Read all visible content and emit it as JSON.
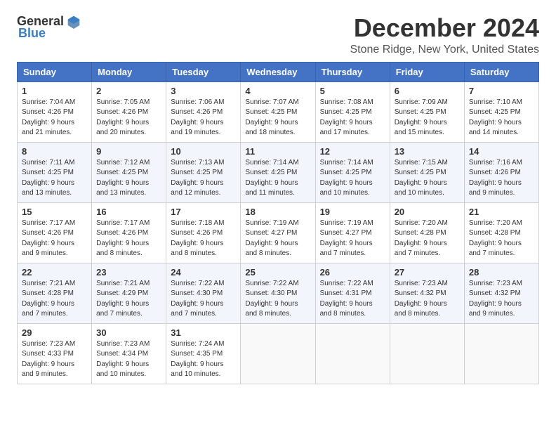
{
  "logo": {
    "general": "General",
    "blue": "Blue"
  },
  "title": "December 2024",
  "subtitle": "Stone Ridge, New York, United States",
  "headers": [
    "Sunday",
    "Monday",
    "Tuesday",
    "Wednesday",
    "Thursday",
    "Friday",
    "Saturday"
  ],
  "weeks": [
    [
      {
        "day": "1",
        "sunrise": "7:04 AM",
        "sunset": "4:26 PM",
        "daylight": "9 hours and 21 minutes."
      },
      {
        "day": "2",
        "sunrise": "7:05 AM",
        "sunset": "4:26 PM",
        "daylight": "9 hours and 20 minutes."
      },
      {
        "day": "3",
        "sunrise": "7:06 AM",
        "sunset": "4:26 PM",
        "daylight": "9 hours and 19 minutes."
      },
      {
        "day": "4",
        "sunrise": "7:07 AM",
        "sunset": "4:25 PM",
        "daylight": "9 hours and 18 minutes."
      },
      {
        "day": "5",
        "sunrise": "7:08 AM",
        "sunset": "4:25 PM",
        "daylight": "9 hours and 17 minutes."
      },
      {
        "day": "6",
        "sunrise": "7:09 AM",
        "sunset": "4:25 PM",
        "daylight": "9 hours and 15 minutes."
      },
      {
        "day": "7",
        "sunrise": "7:10 AM",
        "sunset": "4:25 PM",
        "daylight": "9 hours and 14 minutes."
      }
    ],
    [
      {
        "day": "8",
        "sunrise": "7:11 AM",
        "sunset": "4:25 PM",
        "daylight": "9 hours and 13 minutes."
      },
      {
        "day": "9",
        "sunrise": "7:12 AM",
        "sunset": "4:25 PM",
        "daylight": "9 hours and 13 minutes."
      },
      {
        "day": "10",
        "sunrise": "7:13 AM",
        "sunset": "4:25 PM",
        "daylight": "9 hours and 12 minutes."
      },
      {
        "day": "11",
        "sunrise": "7:14 AM",
        "sunset": "4:25 PM",
        "daylight": "9 hours and 11 minutes."
      },
      {
        "day": "12",
        "sunrise": "7:14 AM",
        "sunset": "4:25 PM",
        "daylight": "9 hours and 10 minutes."
      },
      {
        "day": "13",
        "sunrise": "7:15 AM",
        "sunset": "4:25 PM",
        "daylight": "9 hours and 10 minutes."
      },
      {
        "day": "14",
        "sunrise": "7:16 AM",
        "sunset": "4:26 PM",
        "daylight": "9 hours and 9 minutes."
      }
    ],
    [
      {
        "day": "15",
        "sunrise": "7:17 AM",
        "sunset": "4:26 PM",
        "daylight": "9 hours and 9 minutes."
      },
      {
        "day": "16",
        "sunrise": "7:17 AM",
        "sunset": "4:26 PM",
        "daylight": "9 hours and 8 minutes."
      },
      {
        "day": "17",
        "sunrise": "7:18 AM",
        "sunset": "4:26 PM",
        "daylight": "9 hours and 8 minutes."
      },
      {
        "day": "18",
        "sunrise": "7:19 AM",
        "sunset": "4:27 PM",
        "daylight": "9 hours and 8 minutes."
      },
      {
        "day": "19",
        "sunrise": "7:19 AM",
        "sunset": "4:27 PM",
        "daylight": "9 hours and 7 minutes."
      },
      {
        "day": "20",
        "sunrise": "7:20 AM",
        "sunset": "4:28 PM",
        "daylight": "9 hours and 7 minutes."
      },
      {
        "day": "21",
        "sunrise": "7:20 AM",
        "sunset": "4:28 PM",
        "daylight": "9 hours and 7 minutes."
      }
    ],
    [
      {
        "day": "22",
        "sunrise": "7:21 AM",
        "sunset": "4:28 PM",
        "daylight": "9 hours and 7 minutes."
      },
      {
        "day": "23",
        "sunrise": "7:21 AM",
        "sunset": "4:29 PM",
        "daylight": "9 hours and 7 minutes."
      },
      {
        "day": "24",
        "sunrise": "7:22 AM",
        "sunset": "4:30 PM",
        "daylight": "9 hours and 7 minutes."
      },
      {
        "day": "25",
        "sunrise": "7:22 AM",
        "sunset": "4:30 PM",
        "daylight": "9 hours and 8 minutes."
      },
      {
        "day": "26",
        "sunrise": "7:22 AM",
        "sunset": "4:31 PM",
        "daylight": "9 hours and 8 minutes."
      },
      {
        "day": "27",
        "sunrise": "7:23 AM",
        "sunset": "4:32 PM",
        "daylight": "9 hours and 8 minutes."
      },
      {
        "day": "28",
        "sunrise": "7:23 AM",
        "sunset": "4:32 PM",
        "daylight": "9 hours and 9 minutes."
      }
    ],
    [
      {
        "day": "29",
        "sunrise": "7:23 AM",
        "sunset": "4:33 PM",
        "daylight": "9 hours and 9 minutes."
      },
      {
        "day": "30",
        "sunrise": "7:23 AM",
        "sunset": "4:34 PM",
        "daylight": "9 hours and 10 minutes."
      },
      {
        "day": "31",
        "sunrise": "7:24 AM",
        "sunset": "4:35 PM",
        "daylight": "9 hours and 10 minutes."
      },
      null,
      null,
      null,
      null
    ]
  ]
}
